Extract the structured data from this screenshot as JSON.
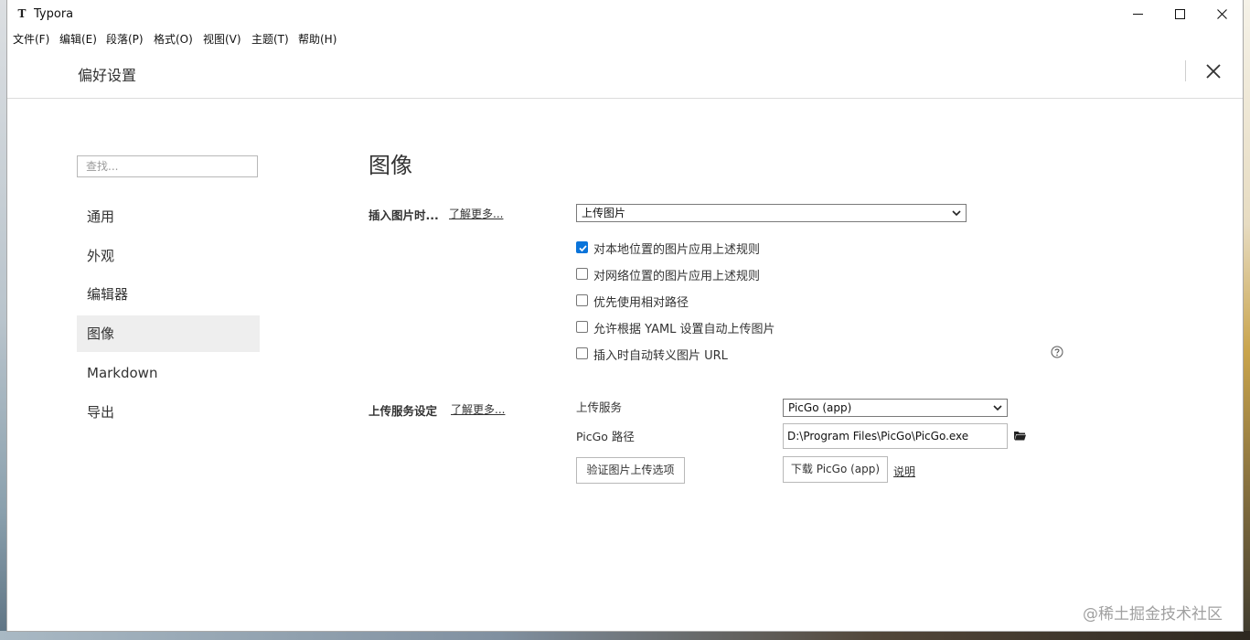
{
  "window": {
    "app_icon_letter": "T",
    "title": "Typora"
  },
  "menu": [
    {
      "label": "文件(F)"
    },
    {
      "label": "编辑(E)"
    },
    {
      "label": "段落(P)"
    },
    {
      "label": "格式(O)"
    },
    {
      "label": "视图(V)"
    },
    {
      "label": "主题(T)"
    },
    {
      "label": "帮助(H)"
    }
  ],
  "preferences": {
    "title": "偏好设置"
  },
  "sidebar": {
    "search_placeholder": "查找...",
    "items": [
      {
        "label": "通用",
        "active": false
      },
      {
        "label": "外观",
        "active": false
      },
      {
        "label": "编辑器",
        "active": false
      },
      {
        "label": "图像",
        "active": true
      },
      {
        "label": "Markdown",
        "active": false
      },
      {
        "label": "导出",
        "active": false
      }
    ]
  },
  "image_section": {
    "title": "图像",
    "insert_label": "插入图片时...",
    "insert_learn_more": "了解更多...",
    "insert_action_value": "上传图片",
    "checkboxes": [
      {
        "label": "对本地位置的图片应用上述规则",
        "checked": true
      },
      {
        "label": "对网络位置的图片应用上述规则",
        "checked": false
      },
      {
        "label": "优先使用相对路径",
        "checked": false
      },
      {
        "label": "允许根据 YAML 设置自动上传图片",
        "checked": false
      },
      {
        "label": "插入时自动转义图片 URL",
        "checked": false
      }
    ],
    "upload_label": "上传服务设定",
    "upload_learn_more": "了解更多...",
    "service_label": "上传服务",
    "service_value": "PicGo (app)",
    "path_label": "PicGo 路径",
    "path_value": "D:\\Program Files\\PicGo\\PicGo.exe",
    "verify_button": "验证图片上传选项",
    "download_button": "下载 PicGo (app)",
    "help_link": "说明"
  },
  "watermark": "@稀土掘金技术社区",
  "colors": {
    "checkbox_checked": "#0a74da",
    "active_nav_bg": "#eeeeee"
  }
}
